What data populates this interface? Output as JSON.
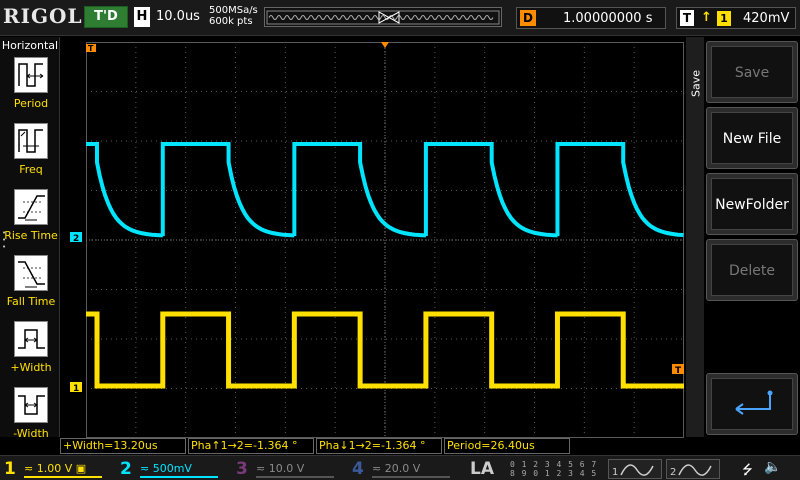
{
  "top": {
    "logo": "RIGOL",
    "trigger_status": "T'D",
    "horizontal_letter": "H",
    "timebase": "10.0us",
    "sample_rate": "500MSa/s",
    "memory_depth": "600k pts",
    "delay_letter": "D",
    "delay": "1.00000000 s",
    "trigger_letter": "T",
    "trigger_edge": "↑",
    "trigger_source": "1",
    "trigger_level": "420mV"
  },
  "left": {
    "title": "Horizontal",
    "items": [
      {
        "label": "Period",
        "icon": "period-measure-icon"
      },
      {
        "label": "Freq",
        "icon": "frequency-measure-icon"
      },
      {
        "label": "Rise Time",
        "icon": "rise-time-icon"
      },
      {
        "label": "Fall Time",
        "icon": "fall-time-icon"
      },
      {
        "label": "+Width",
        "icon": "positive-width-icon"
      },
      {
        "label": "-Width",
        "icon": "negative-width-icon"
      }
    ]
  },
  "markers": {
    "trigger_pos": "T",
    "ch1": "1",
    "ch2": "2",
    "trig_level": "T"
  },
  "right": {
    "menu_title": "Save",
    "keys": [
      {
        "label": "Save",
        "enabled": false
      },
      {
        "label": "New File",
        "enabled": true
      },
      {
        "label": "NewFolder",
        "enabled": true
      },
      {
        "label": "Delete",
        "enabled": false
      },
      {
        "label": "",
        "enabled": true,
        "icon": "return-arrow-icon"
      }
    ]
  },
  "results": {
    "width": "+Width=13.20us",
    "phase_rise_prefix": "Pha",
    "phase_rise": "1→2=-1.364 °",
    "phase_fall_prefix": "Pha",
    "phase_fall": "1→2=-1.364 °",
    "period": "Period=26.40us"
  },
  "channels": [
    {
      "num": "1",
      "coupling": "≂",
      "scale": "1.00 V",
      "color": "#ffe000",
      "active": true
    },
    {
      "num": "2",
      "coupling": "≂",
      "scale": "500mV",
      "color": "#00e5ff",
      "active": true
    },
    {
      "num": "3",
      "coupling": "≂",
      "scale": "10.0 V",
      "color": "#c040c0",
      "active": false
    },
    {
      "num": "4",
      "coupling": "≂",
      "scale": "20.0 V",
      "color": "#3a6fd8",
      "active": false
    }
  ],
  "la": {
    "label": "LA",
    "bits_row1": "0 1 2 3  4 5 6 7",
    "bits_row2": "8 9 0 1  2 3 4 5"
  },
  "generators": {
    "g1": "1",
    "g2": "2"
  },
  "colors": {
    "ch1": "#ffe000",
    "ch2": "#00e5ff",
    "trigger_marker": "#ff8c00",
    "grid": "#5a5a5a"
  }
}
